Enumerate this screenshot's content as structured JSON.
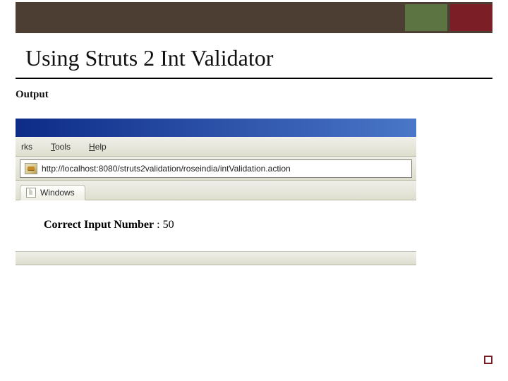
{
  "slide": {
    "title": "Using Struts 2 Int Validator",
    "subtitle": "Output"
  },
  "browser": {
    "menu": {
      "bookmarks_fragment": "rks",
      "tools": "Tools",
      "help": "Help"
    },
    "url": "http://localhost:8080/struts2validation/roseindia/intValidation.action",
    "tab_label": "Windows"
  },
  "page": {
    "result_label": "Correct Input Number",
    "result_value": "50"
  }
}
